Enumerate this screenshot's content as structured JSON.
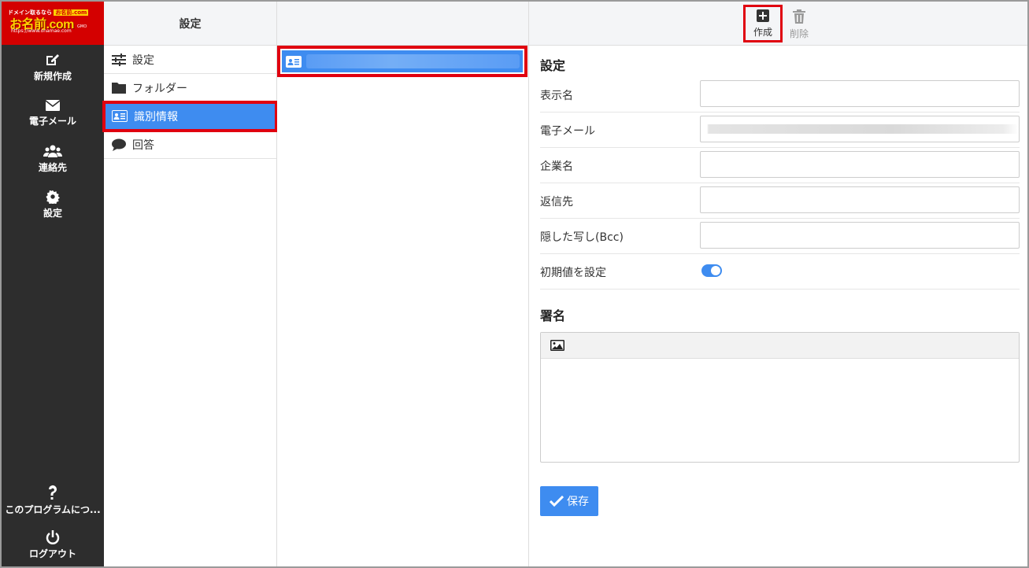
{
  "logo": {
    "tagline": "ドメイン取るなら",
    "badge": "お名前.com",
    "name": "お名前.com",
    "url": "https://www.onamae.com",
    "brand": "GMO"
  },
  "nav": {
    "compose": "新規作成",
    "mail": "電子メール",
    "contacts": "連絡先",
    "settings": "設定",
    "about": "このプログラムにつ...",
    "logout": "ログアウト"
  },
  "settings_column": {
    "title": "設定",
    "items": [
      {
        "label": "設定",
        "icon": "sliders-icon"
      },
      {
        "label": "フォルダー",
        "icon": "folder-icon"
      },
      {
        "label": "識別情報",
        "icon": "id-card-icon",
        "active": true
      },
      {
        "label": "回答",
        "icon": "speech-bubble-icon"
      }
    ]
  },
  "toolbar": {
    "create": "作成",
    "delete": "削除"
  },
  "form": {
    "section_title": "設定",
    "fields": [
      {
        "label": "表示名",
        "value": ""
      },
      {
        "label": "電子メール",
        "value": ""
      },
      {
        "label": "企業名",
        "value": ""
      },
      {
        "label": "返信先",
        "value": ""
      },
      {
        "label": "隠した写し(Bcc)",
        "value": ""
      }
    ],
    "default_label": "初期値を設定",
    "default_on": true,
    "signature_title": "署名",
    "save": "保存"
  },
  "colors": {
    "accent": "#3e8cf0",
    "highlight": "#e0000f",
    "nav_bg": "#2d2d2d",
    "logo_bg": "#d40000"
  }
}
